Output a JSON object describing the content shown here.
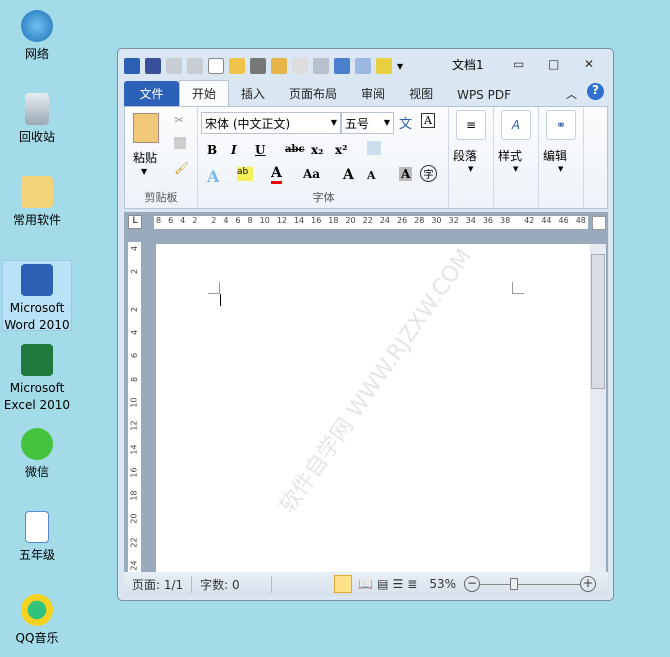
{
  "desktop": [
    {
      "label": "网络"
    },
    {
      "label": "回收站"
    },
    {
      "label": "常用软件"
    },
    {
      "label": "Microsoft Word 2010"
    },
    {
      "label": "Microsoft Excel 2010"
    },
    {
      "label": "微信"
    },
    {
      "label": "五年级"
    },
    {
      "label": "QQ音乐"
    }
  ],
  "window": {
    "title": "文档1"
  },
  "tabs": [
    "文件",
    "开始",
    "插入",
    "页面布局",
    "审阅",
    "视图",
    "WPS PDF"
  ],
  "ribbon": {
    "paste": "粘贴",
    "clipboard": "剪贴板",
    "font_name": "宋体 (中文正文)",
    "font_size": "五号",
    "font_group": "字体",
    "paragraph": "段落",
    "styles": "样式",
    "editing": "编辑",
    "bold": "B",
    "italic": "I",
    "underline": "U",
    "strike": "abc",
    "sub": "x₂",
    "sup": "x²",
    "grow": "A",
    "shrink": "A",
    "case": "Aa"
  },
  "ruler_h": [
    "8",
    "6",
    "4",
    "2",
    "",
    "2",
    "4",
    "6",
    "8",
    "10",
    "12",
    "14",
    "16",
    "18",
    "20",
    "22",
    "24",
    "26",
    "28",
    "30",
    "32",
    "34",
    "36",
    "38",
    "",
    "42",
    "44",
    "46",
    "48"
  ],
  "ruler_v": [
    "4",
    "2",
    "",
    "2",
    "4",
    "6",
    "8",
    "10",
    "12",
    "14",
    "16",
    "18",
    "20",
    "22",
    "24"
  ],
  "watermark": "软件自学网 WWW.RJZXW.COM",
  "status": {
    "page": "页面: 1/1",
    "words": "字数: 0",
    "zoom": "53%"
  },
  "colors": {
    "desktop": "#a3dbe9",
    "file_tab": "#2b61b7"
  }
}
